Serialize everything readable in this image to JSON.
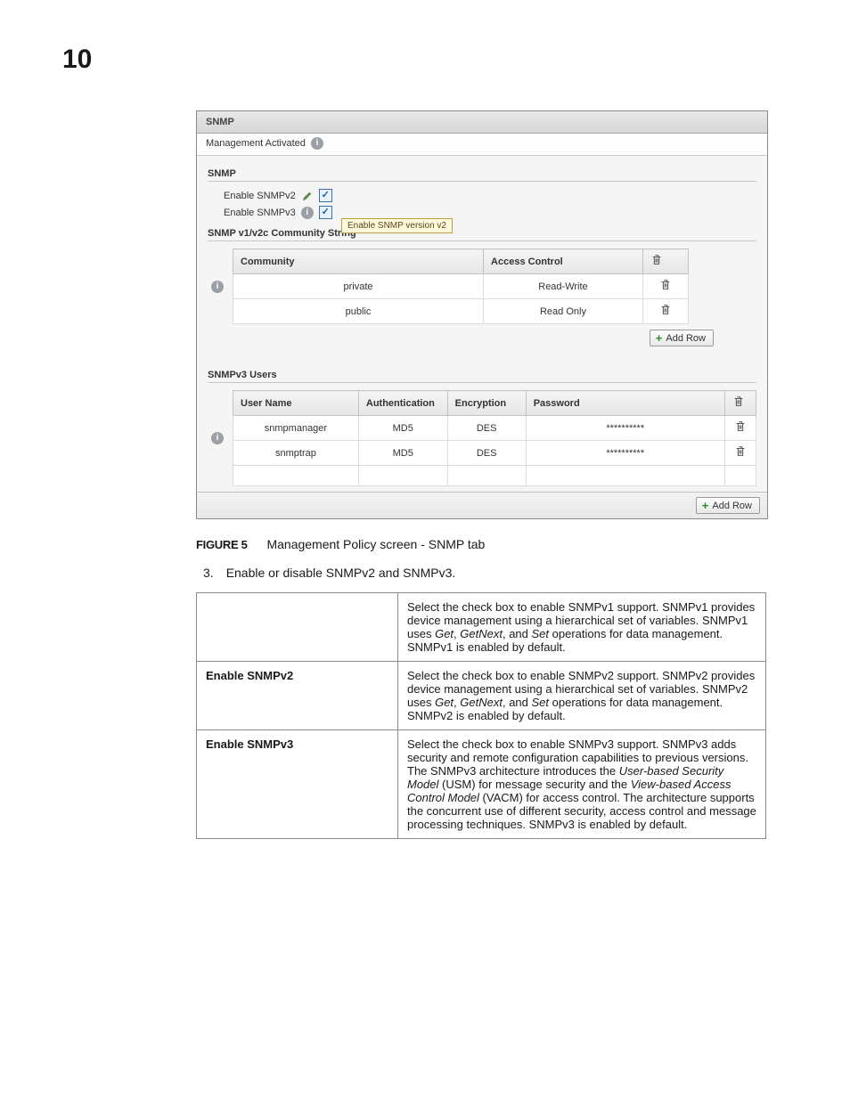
{
  "page_number": "10",
  "screenshot": {
    "title": "SNMP",
    "status_line": "Management Activated",
    "section1_label": "SNMP",
    "enable_v2_label": "Enable SNMPv2",
    "enable_v3_label": "Enable SNMPv3",
    "tooltip_text": "Enable SNMP version v2",
    "community_section_label": "SNMP v1/v2c Community String",
    "community_headers": {
      "c1": "Community",
      "c2": "Access Control"
    },
    "community_rows": [
      {
        "community": "private",
        "access": "Read-Write"
      },
      {
        "community": "public",
        "access": "Read Only"
      }
    ],
    "add_row_label": "Add Row",
    "users_section_label": "SNMPv3 Users",
    "users_headers": {
      "c1": "User Name",
      "c2": "Authentication",
      "c3": "Encryption",
      "c4": "Password"
    },
    "users_rows": [
      {
        "user": "snmpmanager",
        "auth": "MD5",
        "enc": "DES",
        "pw": "**********"
      },
      {
        "user": "snmptrap",
        "auth": "MD5",
        "enc": "DES",
        "pw": "**********"
      }
    ]
  },
  "figure": {
    "label": "FIGURE 5",
    "caption": "Management Policy screen - SNMP tab"
  },
  "step": {
    "num": "3.",
    "text": "Enable or disable SNMPv2 and SNMPv3."
  },
  "desc": {
    "row1_label": "",
    "row1_pre": "Select the check box to enable SNMPv1 support. SNMPv1 provides device management using a hierarchical set of variables. SNMPv1 uses ",
    "row1_i1": "Get",
    "row1_sep1": ", ",
    "row1_i2": "GetNext",
    "row1_sep2": ", and ",
    "row1_i3": "Set",
    "row1_post": " operations for data management. SNMPv1 is enabled by default.",
    "row2_label": "Enable SNMPv2",
    "row2_pre": "Select the check box to enable SNMPv2 support. SNMPv2 provides device management using a hierarchical set of variables. SNMPv2 uses ",
    "row2_i1": "Get",
    "row2_sep1": ", ",
    "row2_i2": "GetNext",
    "row2_sep2": ", and ",
    "row2_i3": "Set",
    "row2_post": " operations for data management. SNMPv2 is enabled by default.",
    "row3_label": "Enable SNMPv3",
    "row3_pre": "Select the check box to enable SNMPv3 support. SNMPv3 adds security and remote configuration capabilities to previous versions. The SNMPv3 architecture introduces the ",
    "row3_i1": "User-based Security Model",
    "row3_mid1": " (USM) for message security and the ",
    "row3_i2": "View-based Access Control Model",
    "row3_post": " (VACM) for access control. The architecture supports the concurrent use of different security, access control and message processing techniques. SNMPv3 is enabled by default."
  }
}
